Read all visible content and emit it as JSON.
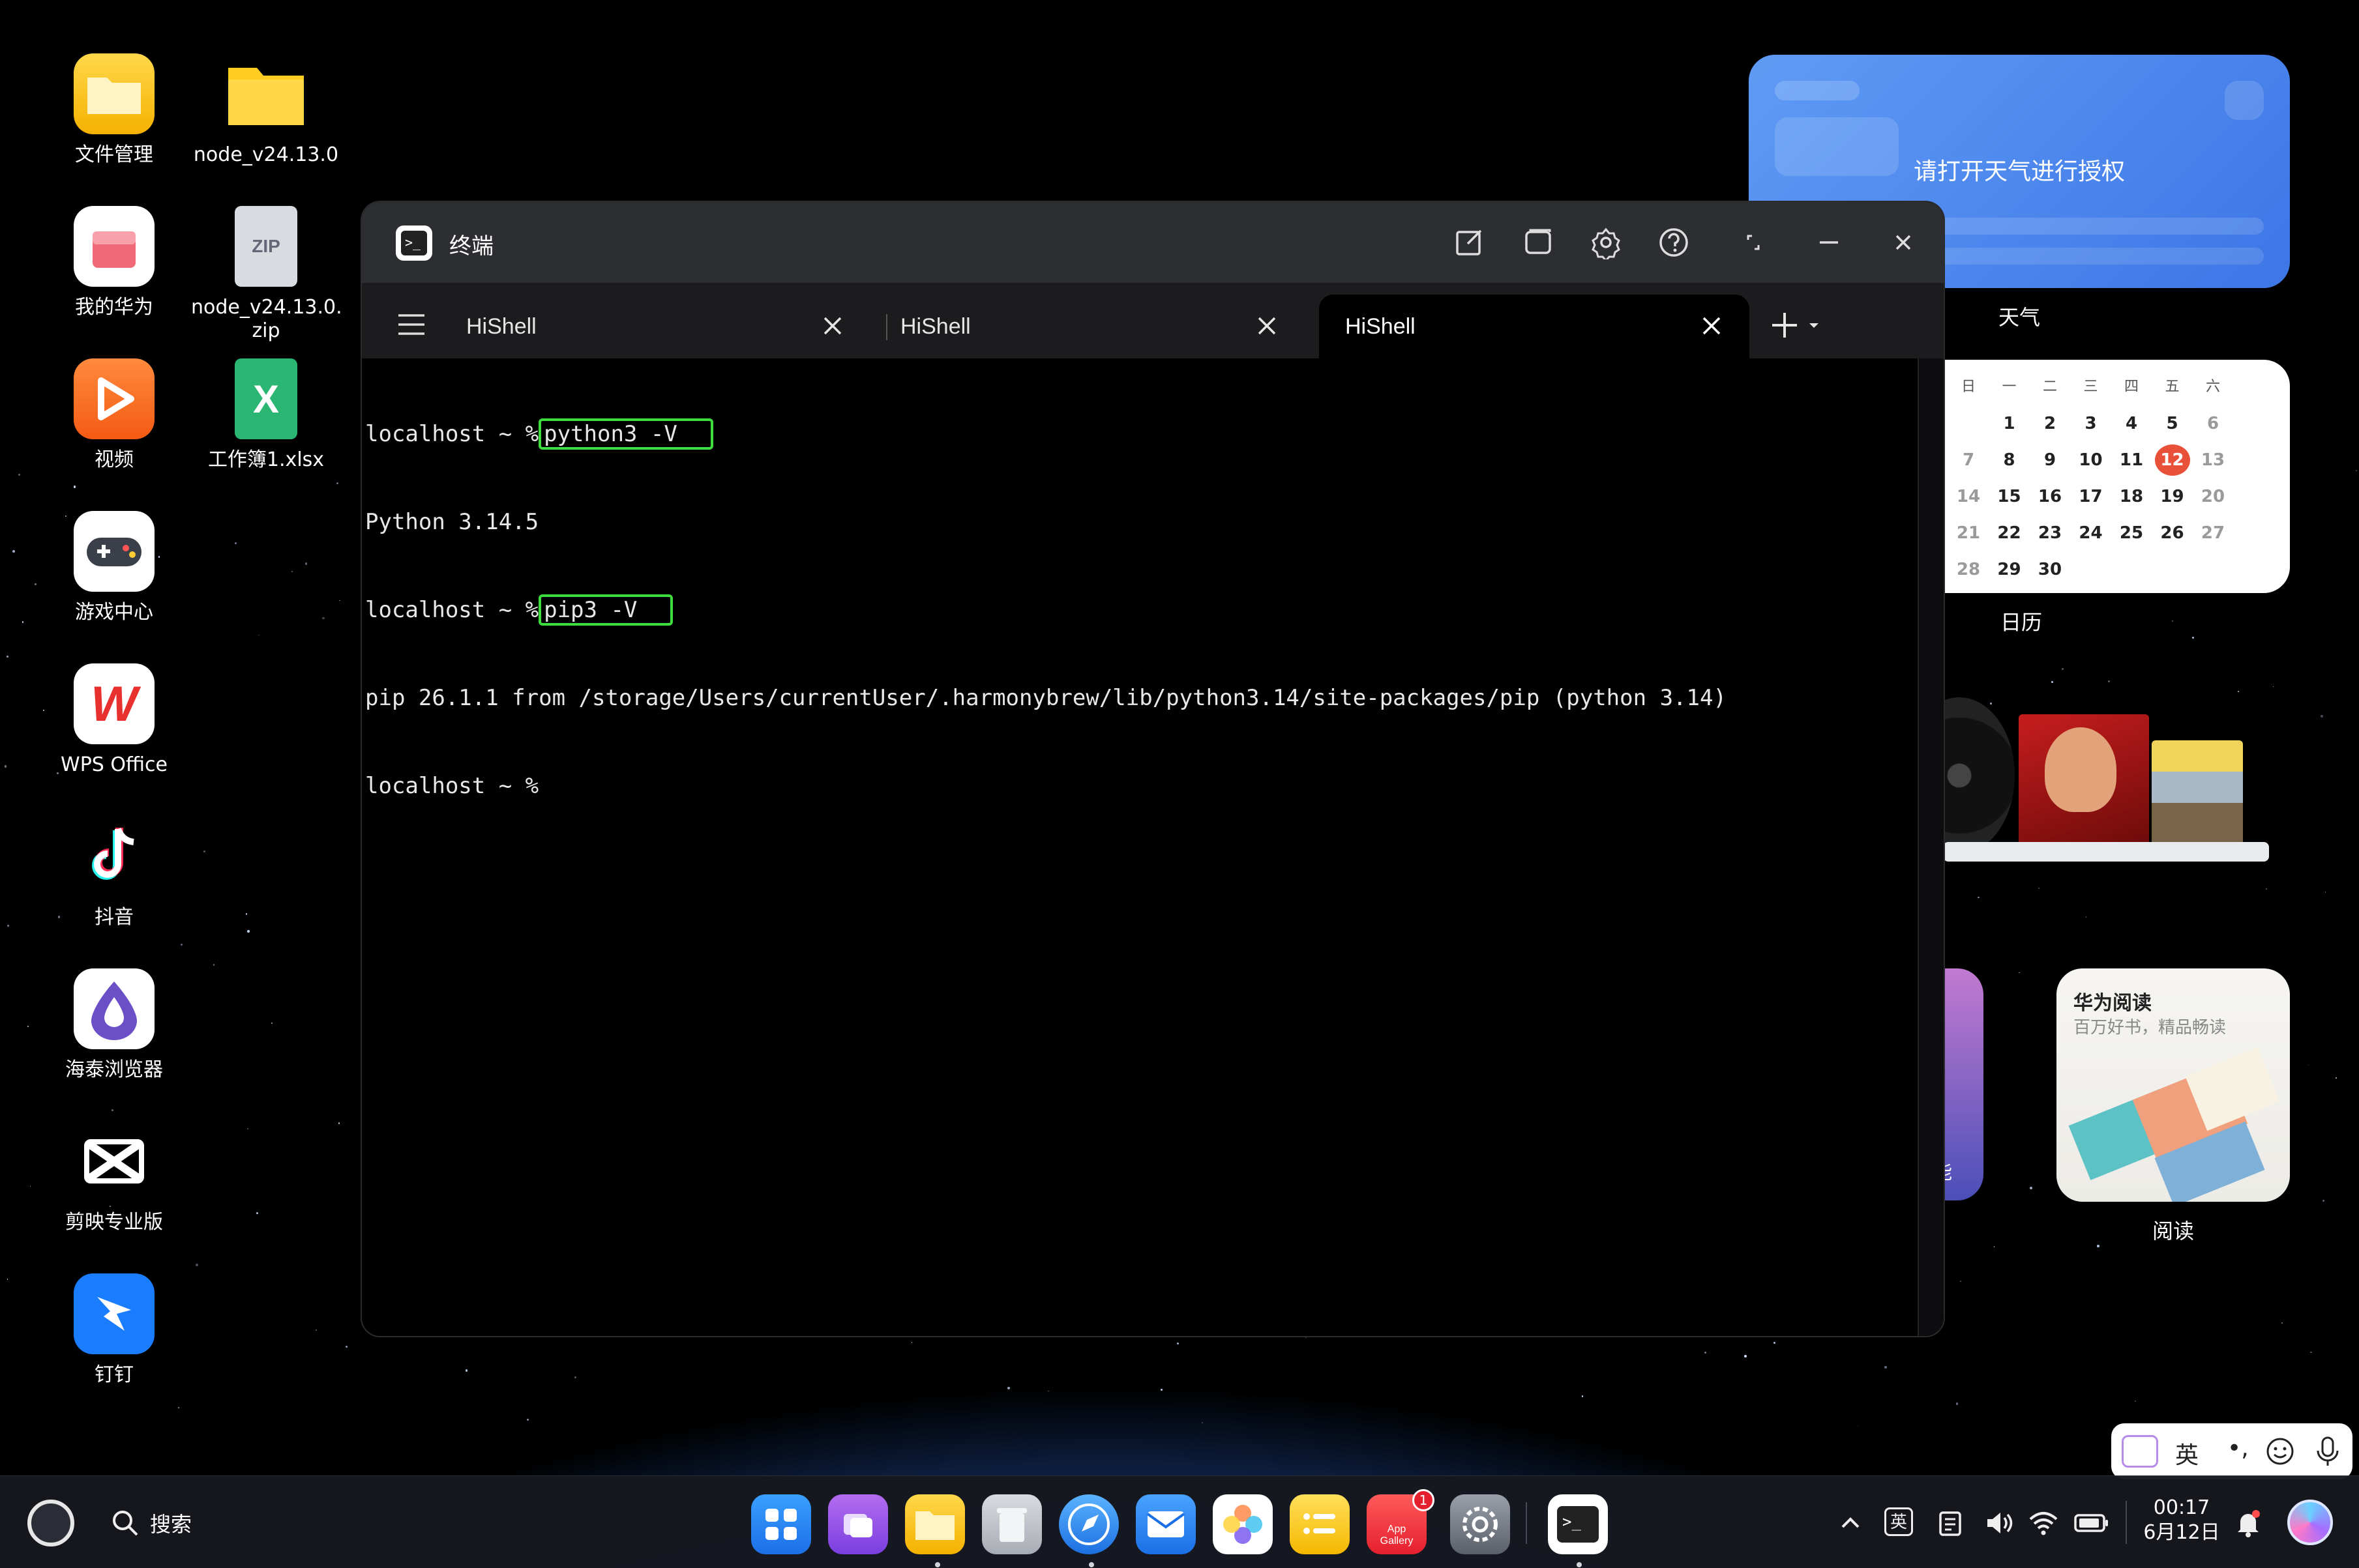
{
  "desktop": {
    "icons": [
      {
        "label": "文件管理"
      },
      {
        "label": "node_v24.13.0"
      },
      {
        "label": "我的华为"
      },
      {
        "label": "node_v24.13.0.\nzip",
        "badge": "ZIP"
      },
      {
        "label": "视频"
      },
      {
        "label": "工作簿1.xlsx",
        "badge": "X"
      },
      {
        "label": "游戏中心"
      },
      {
        "label": "WPS Office",
        "badge": "W"
      },
      {
        "label": "抖音"
      },
      {
        "label": "海泰浏览器"
      },
      {
        "label": "剪映专业版"
      },
      {
        "label": "钉钉"
      }
    ]
  },
  "widgets": {
    "weather": {
      "message": "请打开天气进行授权",
      "caption": "天气"
    },
    "calendar": {
      "caption": "日历",
      "weekdays": [
        "日",
        "一",
        "二",
        "三",
        "四",
        "五",
        "六"
      ],
      "rows": [
        [
          "",
          "1",
          "2",
          "3",
          "4",
          "5",
          "6"
        ],
        [
          "7",
          "8",
          "9",
          "10",
          "11",
          "12",
          "13"
        ],
        [
          "14",
          "15",
          "16",
          "17",
          "18",
          "19",
          "20"
        ],
        [
          "21",
          "22",
          "23",
          "24",
          "25",
          "26",
          "27"
        ],
        [
          "28",
          "29",
          "30",
          "",
          "",
          "",
          ""
        ]
      ],
      "today": "12"
    },
    "reading": {
      "title": "华为阅读",
      "subtitle": "百万好书，精品畅读",
      "caption": "阅读"
    },
    "partial_label": "能"
  },
  "terminal": {
    "title": "终端",
    "tabs": [
      {
        "label": "HiShell",
        "active": false
      },
      {
        "label": "HiShell",
        "active": false
      },
      {
        "label": "HiShell",
        "active": true
      }
    ],
    "lines": [
      {
        "prompt": "localhost ~ %",
        "command": "python3 -V",
        "highlight": true
      },
      {
        "output": "Python 3.14.5"
      },
      {
        "prompt": "localhost ~ %",
        "command": "pip3 -V",
        "highlight": true
      },
      {
        "output": "pip 26.1.1 from /storage/Users/currentUser/.harmonybrew/lib/python3.14/site-packages/pip (python 3.14)"
      },
      {
        "prompt": "localhost ~ %",
        "command": ""
      }
    ],
    "highlight_color": "#3fdc3f"
  },
  "taskbar": {
    "search_label": "搜索",
    "app_store_label": "App\nGallery",
    "app_store_badge": "1",
    "clock_time": "00:17",
    "clock_date": "6月12日",
    "ime_tray_label": "英"
  },
  "ime_bar": {
    "mode_label": "英"
  },
  "colors": {
    "accent_blue": "#4a86ee",
    "today_red": "#e8503a",
    "terminal_bg": "#000000",
    "titlebar_bg": "#2d2e31"
  }
}
